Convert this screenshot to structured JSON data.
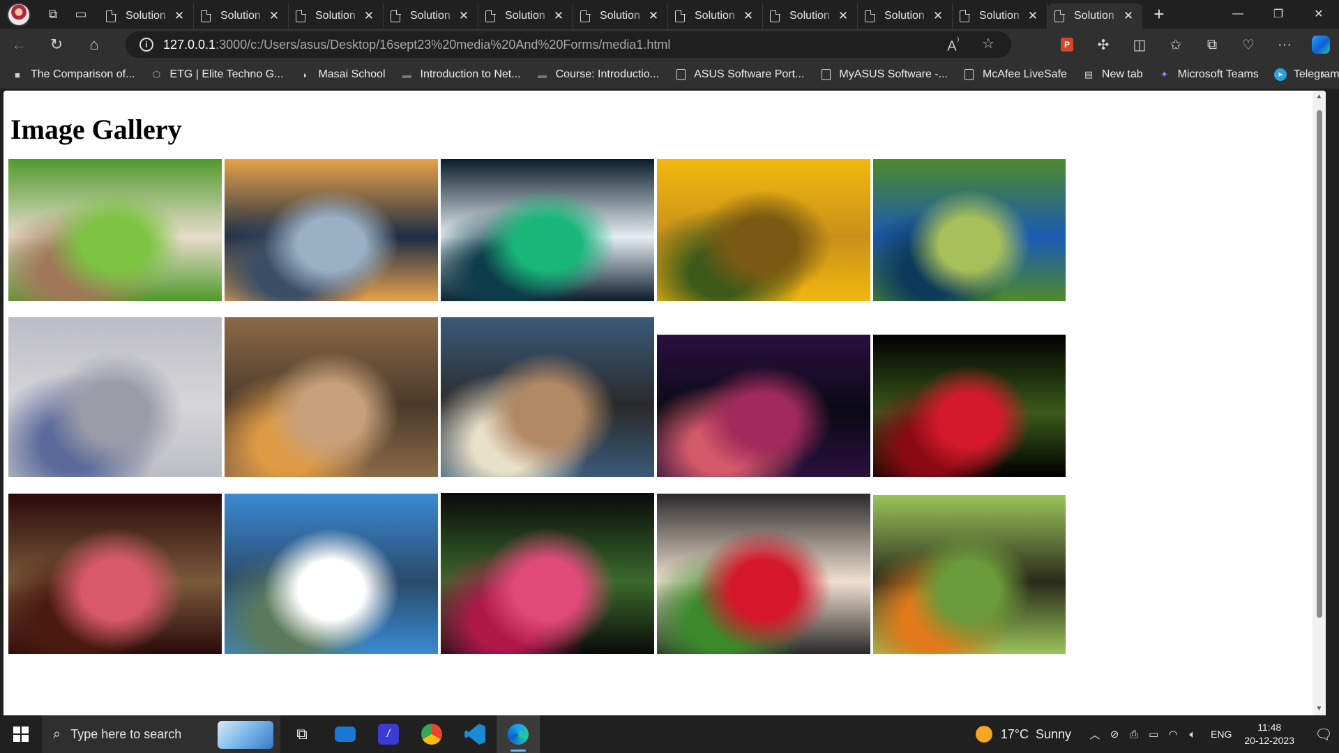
{
  "browser": {
    "tabs": [
      {
        "label": "Solution"
      },
      {
        "label": "Solution"
      },
      {
        "label": "Solution"
      },
      {
        "label": "Solution"
      },
      {
        "label": "Solution"
      },
      {
        "label": "Solution"
      },
      {
        "label": "Solution"
      },
      {
        "label": "Solution"
      },
      {
        "label": "Solution"
      },
      {
        "label": "Solution"
      },
      {
        "label": "Solution"
      }
    ],
    "active_tab_index": 10,
    "new_tab_symbol": "+",
    "address": {
      "host": "127.0.0.1",
      "path": ":3000/c:/Users/asus/Desktop/16sept23%20media%20And%20Forms/media1.html"
    },
    "bookmarks": [
      {
        "label": "The Comparison of...",
        "icon": "bookmark-favicon"
      },
      {
        "label": "ETG | Elite Techno G...",
        "icon": "etg-favicon"
      },
      {
        "label": "Masai School",
        "icon": "masai-favicon"
      },
      {
        "label": "Introduction to Net...",
        "icon": "course-favicon"
      },
      {
        "label": "Course: Introductio...",
        "icon": "course-favicon"
      },
      {
        "label": "ASUS Software Port...",
        "icon": "page-icon"
      },
      {
        "label": "MyASUS Software -...",
        "icon": "page-icon"
      },
      {
        "label": "McAfee LiveSafe",
        "icon": "page-icon"
      },
      {
        "label": "New tab",
        "icon": "newtab-icon"
      },
      {
        "label": "Microsoft Teams",
        "icon": "teams-icon"
      },
      {
        "label": "Telegram",
        "icon": "telegram-icon"
      }
    ]
  },
  "page": {
    "heading": "Image Gallery",
    "images": [
      {
        "subject": "teddy bear held by hand on grass",
        "colors": [
          "#4f9a2c",
          "#7cc442",
          "#a07858",
          "#e8dccb"
        ]
      },
      {
        "subject": "city skyline at sunset",
        "colors": [
          "#e8a24a",
          "#9ab0c4",
          "#3a4e66",
          "#1d2d44"
        ]
      },
      {
        "subject": "aurora over snowy mountains",
        "colors": [
          "#0b1d2a",
          "#19b67a",
          "#0d3d4a",
          "#e6eef3"
        ]
      },
      {
        "subject": "sunflowers field",
        "colors": [
          "#f3b80e",
          "#7a5a12",
          "#3d5a1a",
          "#c8901a"
        ]
      },
      {
        "subject": "peacock with open feathers",
        "colors": [
          "#4e8a2a",
          "#a7c05a",
          "#0c3a5a",
          "#1a5ab4"
        ]
      },
      {
        "subject": "turtle on sand",
        "colors": [
          "#bcbcc4",
          "#9c9ca8",
          "#5a6a9a",
          "#d6d6da"
        ]
      },
      {
        "subject": "woman in autumn leaves",
        "colors": [
          "#8a6a48",
          "#c8a07a",
          "#e09a44",
          "#4a3a2a"
        ]
      },
      {
        "subject": "city street with buildings",
        "colors": [
          "#3a5a7a",
          "#b08864",
          "#e8e0c8",
          "#2a2a2a"
        ]
      },
      {
        "subject": "tree silhouette at purple sunset",
        "colors": [
          "#2a1040",
          "#a02a5a",
          "#d45a6a",
          "#0a0a14"
        ]
      },
      {
        "subject": "red rose on black",
        "colors": [
          "#000000",
          "#d41a2a",
          "#8a0a14",
          "#3a5a1a"
        ]
      },
      {
        "subject": "pink rose in vase",
        "colors": [
          "#2a0a0a",
          "#d85a6a",
          "#4a1a10",
          "#7a5a3a"
        ]
      },
      {
        "subject": "man with open arms at mountains",
        "colors": [
          "#3a8ad4",
          "#ffffff",
          "#5a7a5a",
          "#2a4a6a"
        ]
      },
      {
        "subject": "pink gerbera flower",
        "colors": [
          "#0a0a0a",
          "#e04a7a",
          "#b0184a",
          "#3a6a2a"
        ]
      },
      {
        "subject": "strawberries and cream",
        "colors": [
          "#2a2a2a",
          "#d4182a",
          "#3a8a2a",
          "#f0e0d0"
        ]
      },
      {
        "subject": "monarch butterfly on flowers",
        "colors": [
          "#9ac45a",
          "#6a9a3a",
          "#e07a1a",
          "#2a2a1a"
        ]
      }
    ]
  },
  "taskbar": {
    "search_placeholder": "Type here to search",
    "apps": [
      {
        "name": "task-view",
        "color": "#e8e8e8"
      },
      {
        "name": "mail",
        "color": "#1a78d4"
      },
      {
        "name": "notes-app",
        "color": "#3a3ad4"
      },
      {
        "name": "chrome",
        "color": "#e0a020"
      },
      {
        "name": "vscode",
        "color": "#1a8ad4"
      },
      {
        "name": "edge",
        "color": "#1a9ad4"
      }
    ],
    "weather": {
      "temp": "17°C",
      "condition": "Sunny"
    },
    "language": "ENG",
    "time": "11:48",
    "date": "20-12-2023"
  },
  "colors": {
    "chrome_dark": "#202020",
    "toolbar": "#303030",
    "page_bg": "#ffffff",
    "accent": "#60b8ff"
  }
}
